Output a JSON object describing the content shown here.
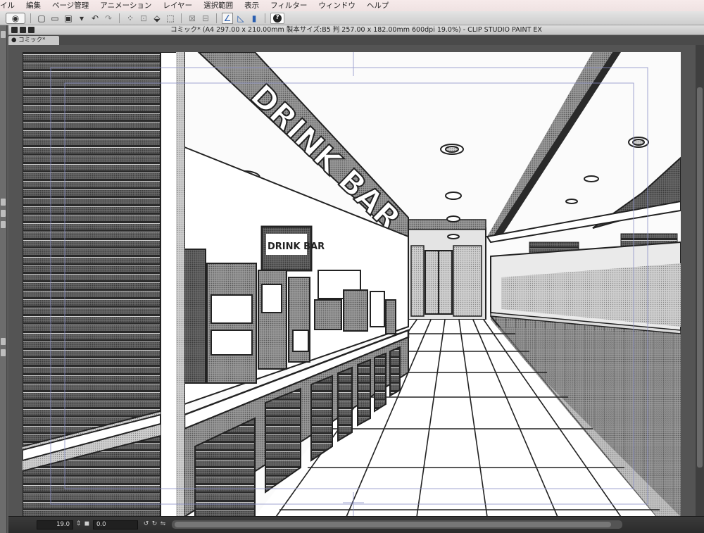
{
  "menubar": {
    "items": [
      "イル",
      "編集",
      "ページ管理",
      "アニメーション",
      "レイヤー",
      "選択範囲",
      "表示",
      "フィルター",
      "ウィンドウ",
      "ヘルプ"
    ]
  },
  "toolbar": {
    "help_label": "?"
  },
  "window": {
    "title": "コミック* (A4 297.00 x 210.00mm 製本サイズ:B5 判 257.00 x 182.00mm 600dpi 19.0%)  - CLIP STUDIO PAINT EX"
  },
  "tabs": [
    {
      "label": "コミック*"
    }
  ],
  "canvas": {
    "sign_text": "DRINK BAR",
    "small_sign_text": "DRINK BAR"
  },
  "statusbar": {
    "zoom": "19.0",
    "angle": "0.0"
  },
  "colors": {
    "canvas_bg": "#fafafa",
    "chrome_dark": "#3a3a3a",
    "menubar_bg": "#f6eaea"
  }
}
